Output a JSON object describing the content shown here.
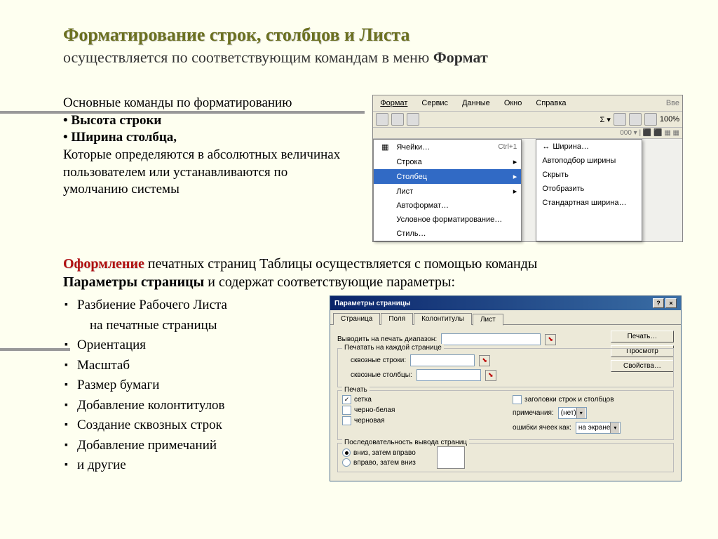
{
  "title": "Форматирование строк, столбцов и Листа",
  "subtitle_pre": "осуществляется   по соответствующим командам в меню ",
  "subtitle_bold": "Формат",
  "sec1": {
    "line1": "Основные команды по форматированию",
    "b1": "Высота строки",
    "b2": "Ширина столбца,",
    "line2": "Которые определяются в абсолютных величинах пользователем или устанавливаются по умолчанию системы"
  },
  "menu": {
    "bar": [
      "Формат",
      "Сервис",
      "Данные",
      "Окно",
      "Справка"
    ],
    "vve": "Вве",
    "zoom": "100%",
    "items": {
      "cells": "Ячейки…",
      "cells_sc": "Ctrl+1",
      "row": "Строка",
      "col": "Столбец",
      "sheet": "Лист",
      "autof": "Автоформат…",
      "cond": "Условное форматирование…",
      "style": "Стиль…"
    },
    "sub": {
      "width": "Ширина…",
      "autofit": "Автоподбор ширины",
      "hide": "Скрыть",
      "show": "Отобразить",
      "std": "Стандартная ширина…"
    }
  },
  "oform": {
    "red": "Оформление",
    "t1": " печатных страниц Таблицы осуществляется с помощью команды ",
    "bold": "Параметры страницы",
    "t2": " и содержат соответствующие параметры:",
    "list": [
      "Разбиение Рабочего Листа",
      "   на печатные страницы",
      "Ориентация",
      "Масштаб",
      "Размер бумаги",
      "Добавление колонтитулов",
      "Создание сквозных строк",
      "Добавление примечаний",
      "и другие"
    ]
  },
  "dlg": {
    "title": "Параметры страницы",
    "tabs": [
      "Страница",
      "Поля",
      "Колонтитулы",
      "Лист"
    ],
    "print_range": "Выводить на печать диапазон:",
    "each_page": "Печатать на каждой странице",
    "through_rows": "сквозные строки:",
    "through_cols": "сквозные столбцы:",
    "print_group": "Печать",
    "cb_grid": "сетка",
    "cb_bw": "черно-белая",
    "cb_draft": "черновая",
    "cb_headers": "заголовки строк и столбцов",
    "notes": "примечания:",
    "notes_val": "(нет)",
    "errors": "ошибки ячеек как:",
    "errors_val": "на экране",
    "order": "Последовательность вывода страниц",
    "r1": "вниз, затем вправо",
    "r2": "вправо, затем вниз",
    "btn_print": "Печать…",
    "btn_preview": "Просмотр",
    "btn_props": "Свойства…"
  }
}
